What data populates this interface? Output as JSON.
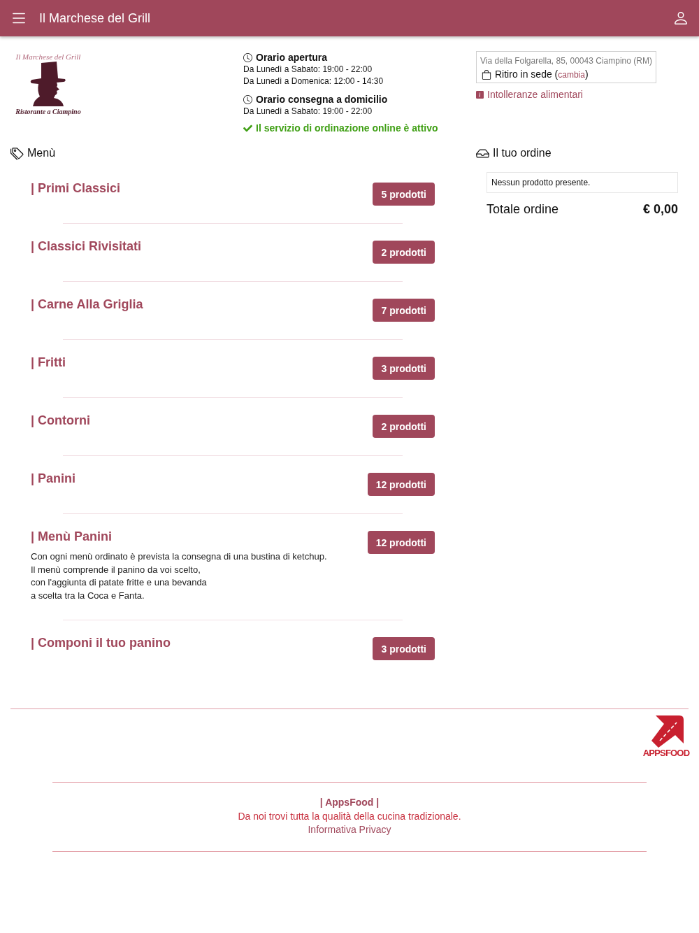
{
  "header": {
    "title": "Il Marchese del Grill"
  },
  "logo": {
    "title": "Il Marchese del Grill",
    "subtitle": "Ristorante a Ciampino"
  },
  "hours": [
    {
      "title": "Orario apertura",
      "lines": [
        "Da Lunedì a Sabato: 19:00 - 22:00",
        "Da Lunedì a Domenica: 12:00 - 14:30"
      ]
    },
    {
      "title": "Orario consegna a domicilio",
      "lines": [
        "Da Lunedì a Sabato: 19:00 - 22:00"
      ]
    }
  ],
  "online_status": {
    "text": "Il servizio di ordinazione online è attivo",
    "active": true
  },
  "location": {
    "address": "Via della Folgarella, 85, 00043 Ciampino (RM)",
    "mode_before": "Ritiro in sede (",
    "change_link": "cambia",
    "mode_after": ")"
  },
  "allergens_link": "Intolleranze alimentari",
  "menu": {
    "heading": "Menù",
    "categories": [
      {
        "name": "| Primi Classici",
        "count": "5 prodotti"
      },
      {
        "name": "| Classici Rivisitati",
        "count": "2 prodotti"
      },
      {
        "name": "| Carne Alla Griglia",
        "count": "7 prodotti"
      },
      {
        "name": "| Fritti",
        "count": "3 prodotti"
      },
      {
        "name": "| Contorni",
        "count": "2 prodotti"
      },
      {
        "name": "| Panini",
        "count": "12 prodotti"
      },
      {
        "name": "| Menù Panini",
        "count": "12 prodotti",
        "description": [
          "Con ogni menù ordinato è prevista la consegna di una bustina di ketchup.",
          "Il menù comprende il panino da voi scelto,",
          "con l'aggiunta di patate fritte e una bevanda",
          "a scelta tra la Coca e Fanta."
        ]
      },
      {
        "name": "| Componi il tuo panino",
        "count": "3 prodotti"
      }
    ]
  },
  "order": {
    "heading": "Il tuo ordine",
    "empty_message": "Nessun prodotto presente.",
    "total_label": "Totale ordine",
    "total": "€ 0,00"
  },
  "footer": {
    "logo_text": "APPSFOOD",
    "brand": "| AppsFood |",
    "tagline": "Da noi trovi tutta la qualità della cucina tradizionale.",
    "privacy_link": "Informativa Privacy"
  }
}
